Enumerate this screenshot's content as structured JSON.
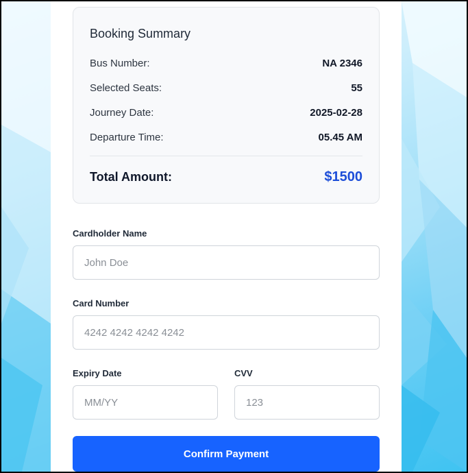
{
  "summary": {
    "title": "Booking Summary",
    "rows": [
      {
        "label": "Bus Number:",
        "value": "NA 2346"
      },
      {
        "label": "Selected Seats:",
        "value": "55"
      },
      {
        "label": "Journey Date:",
        "value": "2025-02-28"
      },
      {
        "label": "Departure Time:",
        "value": "05.45 AM"
      }
    ],
    "total_label": "Total Amount:",
    "total_value": "$1500"
  },
  "form": {
    "cardholder_label": "Cardholder Name",
    "cardholder_placeholder": "John Doe",
    "card_number_label": "Card Number",
    "card_number_placeholder": "4242 4242 4242 4242",
    "expiry_label": "Expiry Date",
    "expiry_placeholder": "MM/YY",
    "cvv_label": "CVV",
    "cvv_placeholder": "123",
    "confirm_label": "Confirm Payment"
  },
  "colors": {
    "accent": "#1763ff",
    "total": "#1d4ed8"
  }
}
